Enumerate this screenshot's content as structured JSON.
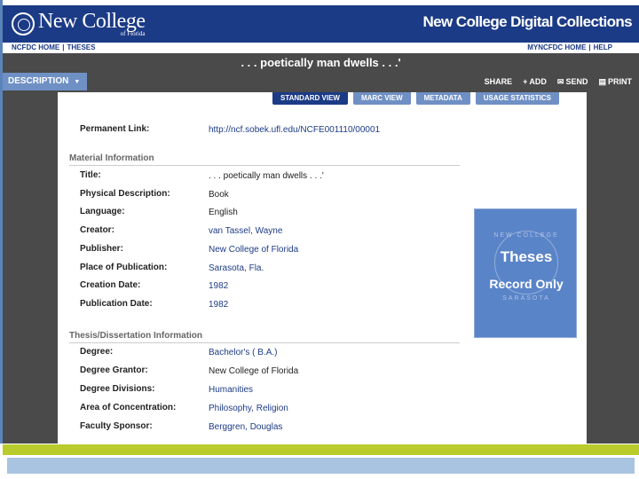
{
  "header": {
    "logo_main": "New College",
    "logo_sub": "of Florida",
    "site_title": "New College Digital Collections"
  },
  "nav": {
    "left": [
      "NCFDC HOME",
      "THESES"
    ],
    "right": [
      "MYNCFDC HOME",
      "HELP"
    ]
  },
  "item_title": ". . . poetically man dwells . . .'",
  "toolbar": {
    "description_tab": "DESCRIPTION",
    "share": "SHARE",
    "add": "ADD",
    "send": "SEND",
    "print": "PRINT"
  },
  "views": [
    "STANDARD VIEW",
    "MARC VIEW",
    "METADATA",
    "USAGE STATISTICS"
  ],
  "permanent_link": {
    "label": "Permanent Link:",
    "value": "http://ncf.sobek.ufl.edu/NCFE001110/00001"
  },
  "material_section": "Material Information",
  "material_fields": [
    {
      "label": "Title:",
      "value": ". . . poetically man dwells . . .'",
      "link": false
    },
    {
      "label": "Physical Description:",
      "value": "Book",
      "link": false
    },
    {
      "label": "Language:",
      "value": "English",
      "link": false
    },
    {
      "label": "Creator:",
      "value": "van Tassel, Wayne",
      "link": true
    },
    {
      "label": "Publisher:",
      "value": "New College of Florida",
      "link": true
    },
    {
      "label": "Place of Publication:",
      "value": "Sarasota, Fla.",
      "link": true
    },
    {
      "label": "Creation Date:",
      "value": "1982",
      "link": true
    },
    {
      "label": "Publication Date:",
      "value": "1982",
      "link": true
    }
  ],
  "thesis_section": "Thesis/Dissertation Information",
  "thesis_fields": [
    {
      "label": "Degree:",
      "value": "Bachelor's ( B.A.)",
      "link": true
    },
    {
      "label": "Degree Grantor:",
      "value": "New College of Florida",
      "link": false
    },
    {
      "label": "Degree Divisions:",
      "value": "Humanities",
      "link": true
    },
    {
      "label": "Area of Concentration:",
      "value": "Philosophy, Religion",
      "link": true
    },
    {
      "label": "Faculty Sponsor:",
      "value": "Berggren, Douglas",
      "link": true
    }
  ],
  "thumbnail": {
    "line1": "Theses",
    "line2": "Record Only",
    "arc_top": "NEW COLLEGE",
    "arc_bottom": "SARASOTA"
  },
  "colors": {
    "brand_blue": "#1c3b86",
    "tab_blue": "#6f90c4",
    "footer_green": "#b9cc2c",
    "footer_blue": "#a9c4e0"
  }
}
